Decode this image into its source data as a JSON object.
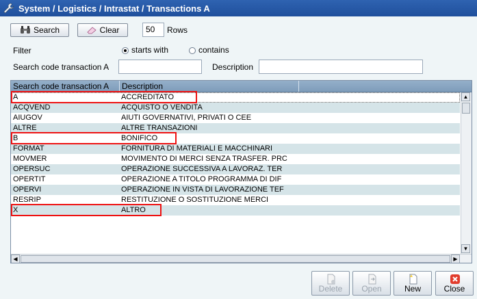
{
  "window": {
    "title": "System / Logistics / Intrastat / Transactions A"
  },
  "toolbar": {
    "search_label": "Search",
    "clear_label": "Clear",
    "rows_value": "50",
    "rows_label": "Rows"
  },
  "filter": {
    "label": "Filter",
    "option_starts": "starts with",
    "option_contains": "contains",
    "selected": "starts with"
  },
  "search": {
    "code_label": "Search code transaction A",
    "code_value": "",
    "desc_label": "Description",
    "desc_value": ""
  },
  "grid": {
    "columns": [
      "Search code transaction A",
      "Description"
    ],
    "rows": [
      {
        "code": "A",
        "description": "ACCREDITATO"
      },
      {
        "code": "ACQVEND",
        "description": "ACQUISTO O VENDITA"
      },
      {
        "code": "AIUGOV",
        "description": "AIUTI GOVERNATIVI, PRIVATI O CEE"
      },
      {
        "code": "ALTRE",
        "description": "ALTRE TRANSAZIONI"
      },
      {
        "code": "B",
        "description": "BONIFICO"
      },
      {
        "code": "FORMAT",
        "description": "FORNITURA DI MATERIALI E MACCHINARI"
      },
      {
        "code": "MOVMER",
        "description": "MOVIMENTO DI MERCI SENZA TRASFER. PRC"
      },
      {
        "code": "OPERSUC",
        "description": "OPERAZIONE SUCCESSIVA A LAVORAZ. TER"
      },
      {
        "code": "OPERTIT",
        "description": "OPERAZIONE A TITOLO  PROGRAMMA DI DIF"
      },
      {
        "code": "OPERVI",
        "description": "OPERAZIONE IN VISTA DI LAVORAZIONE TEF"
      },
      {
        "code": "RESRIP",
        "description": "RESTITUZIONE O SOSTITUZIONE MERCI"
      },
      {
        "code": "X",
        "description": "ALTRO"
      }
    ]
  },
  "buttons": {
    "delete": "Delete",
    "open": "Open",
    "new": "New",
    "close": "Close"
  },
  "icons": {
    "title": "wrench-icon",
    "search": "binoculars-icon",
    "clear": "eraser-icon",
    "delete": "delete-doc-icon",
    "open": "open-doc-icon",
    "new": "new-doc-icon",
    "close": "red-x-icon"
  },
  "colors": {
    "titlebar": "#2f63b1",
    "highlight": "#e11111"
  }
}
